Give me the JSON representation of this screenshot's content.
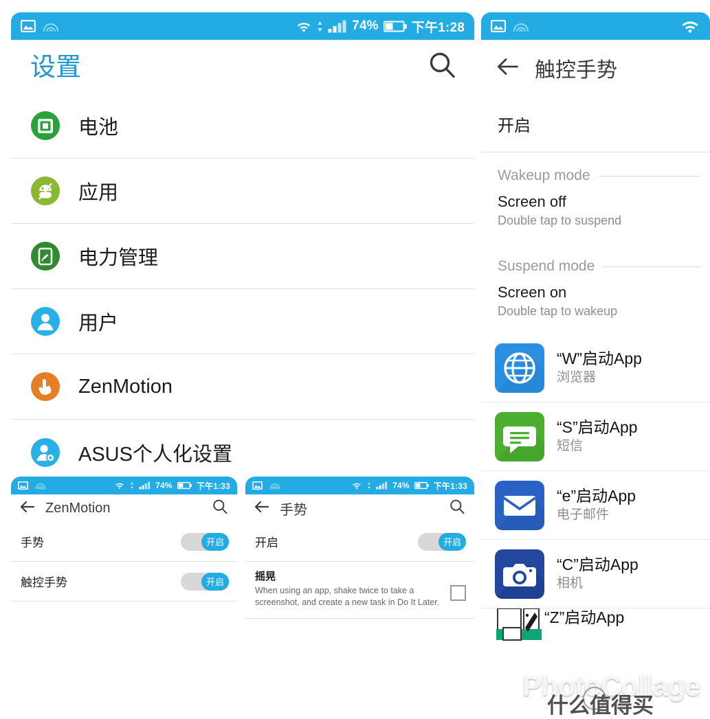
{
  "collage": {
    "watermark": "PhotoCollage",
    "watermark_cn": "什么值得买"
  },
  "status_bar": {
    "battery_text": "74%",
    "time_main": "下午1:28",
    "time_secondary": "下午1:33",
    "icons": [
      "picture-icon",
      "nfc-icon",
      "wifi-icon",
      "data-arrows-icon",
      "signal-bars-icon",
      "battery-icon"
    ]
  },
  "settings_panel": {
    "title": "设置",
    "search_icon": "search-icon",
    "items": [
      {
        "label": "电池",
        "icon": "battery-circle-icon",
        "color": "#27a33a"
      },
      {
        "label": "应用",
        "icon": "android-apps-icon",
        "color": "#8ab832"
      },
      {
        "label": "电力管理",
        "icon": "power-management-icon",
        "color": "#2e8b2e"
      },
      {
        "label": "用户",
        "icon": "user-icon",
        "color": "#29b0e8"
      },
      {
        "label": "ZenMotion",
        "icon": "hand-tap-icon",
        "color": "#e57e25"
      },
      {
        "label": "ASUS个人化设置",
        "icon": "user-gear-icon",
        "color": "#29b0e8"
      }
    ]
  },
  "zenmotion_panel": {
    "back_icon": "back-arrow-icon",
    "title": "ZenMotion",
    "search_icon": "search-icon",
    "rows": [
      {
        "label": "手势",
        "toggle_label": "开启",
        "toggle_on": true
      },
      {
        "label": "触控手势",
        "toggle_label": "开启",
        "toggle_on": true
      }
    ]
  },
  "gesture_panel": {
    "back_icon": "back-arrow-icon",
    "title": "手势",
    "search_icon": "search-icon",
    "enable_row": {
      "label": "开启",
      "toggle_label": "开启",
      "toggle_on": true
    },
    "shake": {
      "title": "摇晃",
      "description": "When using an app, shake twice to take a screenshot, and create a new task in Do It Later.",
      "checked": false
    }
  },
  "touch_panel": {
    "back_icon": "back-arrow-icon",
    "title": "触控手势",
    "enable_label": "开启",
    "sections": [
      {
        "heading": "Wakeup mode",
        "item_title": "Screen off",
        "item_sub": "Double tap to suspend"
      },
      {
        "heading": "Suspend mode",
        "item_title": "Screen on",
        "item_sub": "Double tap to wakeup"
      }
    ],
    "apps": [
      {
        "main": "“W”启动App",
        "sub": "浏览器",
        "icon": "globe-browser-icon",
        "color": "#2a8fe0"
      },
      {
        "main": "“S”启动App",
        "sub": "短信",
        "icon": "message-icon",
        "color": "#4caf2f"
      },
      {
        "main": "“e”启动App",
        "sub": "电子邮件",
        "icon": "email-envelope-icon",
        "color": "#2a62c4"
      },
      {
        "main": "“C”启动App",
        "sub": "相机",
        "icon": "camera-icon",
        "color": "#23479e"
      }
    ],
    "partial_app": {
      "main": "“Z”启动App",
      "icon": "photo-editor-icon",
      "color": "#10a578"
    }
  },
  "colors": {
    "status_blue": "#22ace3",
    "title_blue": "#2196cf",
    "divider": "#e2e2e2",
    "muted_text": "#8e8e8e"
  }
}
